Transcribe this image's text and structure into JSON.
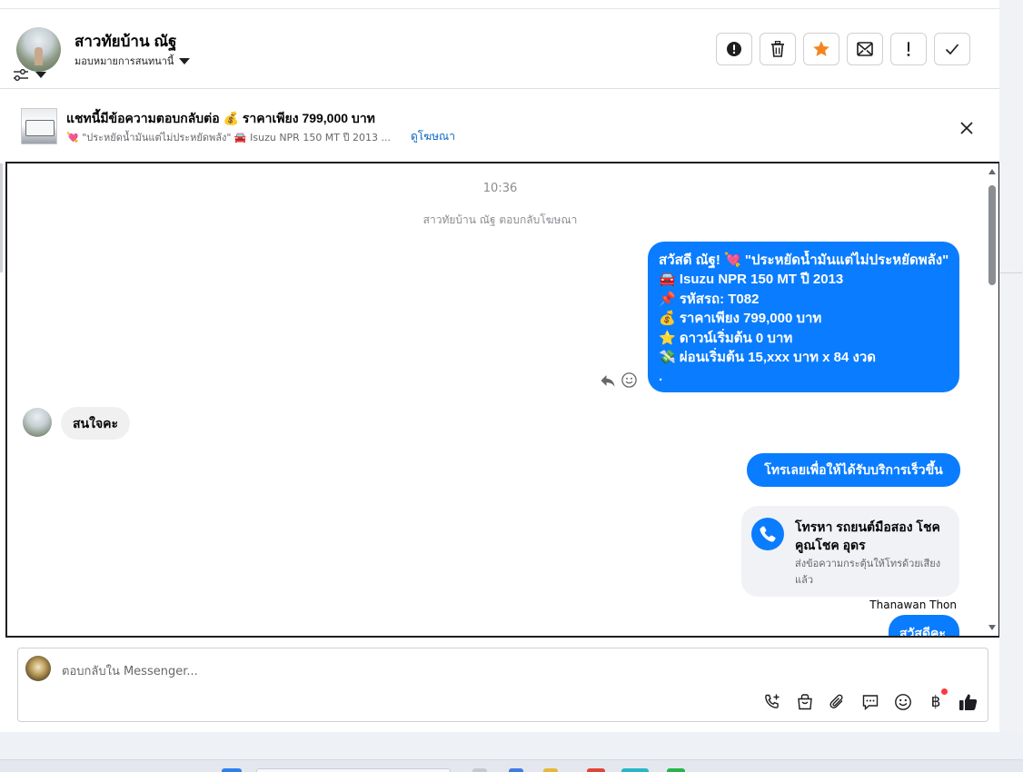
{
  "header": {
    "contact_name": "สาวทัยบ้าน ณัฐ",
    "assign_label": "มอบหมายการสนทนานี้",
    "actions": [
      {
        "icon": "alert-circle-icon"
      },
      {
        "icon": "trash-icon"
      },
      {
        "icon": "star-icon",
        "color": "#f5831f"
      },
      {
        "icon": "mark-unread-icon"
      },
      {
        "icon": "exclamation-icon"
      },
      {
        "icon": "check-icon"
      }
    ]
  },
  "ad": {
    "title": "แชทนี้มีข้อความตอบกลับต่อ 💰 ราคาเพียง 799,000 บาท",
    "subtitle": "💘 \"ประหยัดน้ำมันแต่ไม่ประหยัดพลัง\" 🚘 Isuzu NPR 150 MT ปี 2013 ...",
    "link_label": "ดูโฆษณา"
  },
  "chat": {
    "timestamp": "10:36",
    "reply_note": "สาวทัยบ้าน ณัฐ ตอบกลับโฆษณา",
    "message_1_lines": [
      "สวัสดี ณัฐ! 💘 \"ประหยัดน้ำมันแต่ไม่ประหยัดพลัง\"",
      "🚘 Isuzu NPR 150 MT ปี 2013",
      "📌 รหัสรถ: T082",
      "💰 ราคาเพียง 799,000 บาท",
      "⭐ ดาวน์เริ่มต้น 0 บาท",
      "💸 ผ่อนเริ่มต้น 15,xxx บาท x 84 งวด",
      "."
    ],
    "incoming_message": "สนใจคะ",
    "message_2": "โทรเลยเพื่อให้ได้รับบริการเร็วขึ้น",
    "call_card": {
      "title": "โทรหา รถยนต์มือสอง โชคคูณโชค อุดร",
      "subtitle": "ส่งข้อความกระตุ้นให้โทรด้วยเสียงแล้ว"
    },
    "sender_name": "Thanawan Thon",
    "message_3": "สวัสดีคะ"
  },
  "composer": {
    "placeholder": "ตอบกลับใน Messenger...",
    "tools": [
      "call-add-icon",
      "shopping-bag-icon",
      "paperclip-icon",
      "saved-reply-icon",
      "emoji-icon",
      "baht-icon",
      "thumbs-up-icon"
    ],
    "baht_symbol": "฿"
  },
  "colors": {
    "accent": "#0a7cff",
    "star": "#f5831f",
    "notification_dot": "#fa383e"
  }
}
